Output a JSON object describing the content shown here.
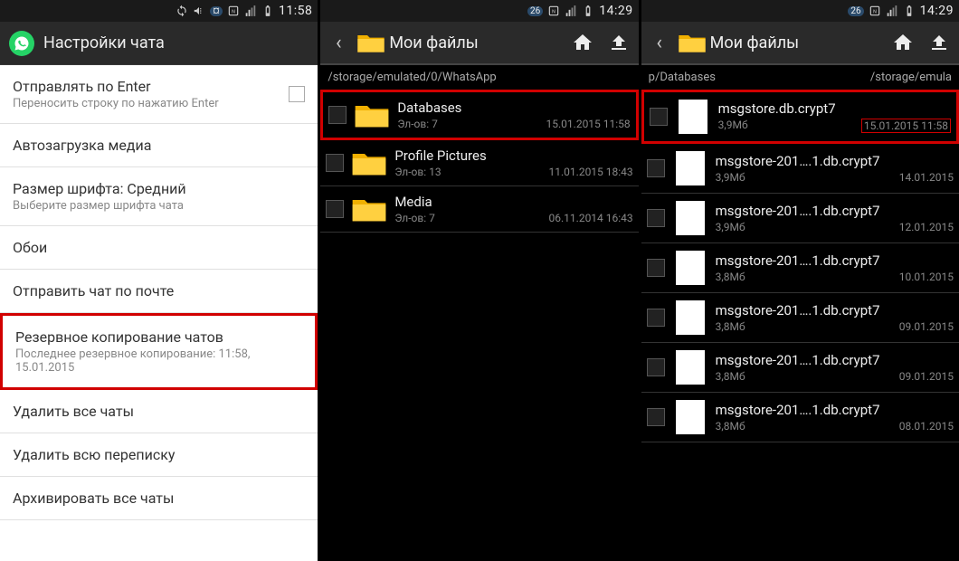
{
  "phone1": {
    "status": {
      "time": "11:58"
    },
    "header": {
      "title": "Настройки чата"
    },
    "settings": [
      {
        "title": "Отправлять по Enter",
        "sub": "Переносить строку по нажатию Enter",
        "checkbox": true
      },
      {
        "title": "Автозагрузка медиа"
      },
      {
        "title": "Размер шрифта: Средний",
        "sub": "Выберите размер шрифта чата"
      },
      {
        "title": "Обои"
      },
      {
        "title": "Отправить чат по почте"
      },
      {
        "title": "Резервное копирование чатов",
        "sub": "Последнее резервное копирование: 11:58, 15.01.2015",
        "highlight": true
      },
      {
        "title": "Удалить все чаты"
      },
      {
        "title": "Удалить всю переписку"
      },
      {
        "title": "Архивировать все чаты"
      }
    ]
  },
  "phone2": {
    "status": {
      "time": "14:29"
    },
    "header": {
      "title": "Мои файлы"
    },
    "path": "/storage/emulated/0/WhatsApp",
    "items": [
      {
        "name": "Databases",
        "meta": "Эл-ов: 7",
        "date": "15.01.2015 11:58",
        "highlight": true
      },
      {
        "name": "Profile Pictures",
        "meta": "Эл-ов: 13",
        "date": "11.01.2015 18:43"
      },
      {
        "name": "Media",
        "meta": "Эл-ов: 7",
        "date": "06.11.2014 16:43"
      }
    ]
  },
  "phone3": {
    "status": {
      "time": "14:29"
    },
    "header": {
      "title": "Мои файлы"
    },
    "path_left": "p/Databases",
    "path_right": "/storage/emula",
    "items": [
      {
        "name": "msgstore.db.crypt7",
        "meta": "3,9Мб",
        "date": "15.01.2015 11:58",
        "highlight": true,
        "date_highlight": true
      },
      {
        "name": "msgstore-201….1.db.crypt7",
        "meta": "3,9Мб",
        "date": "14.01.2015"
      },
      {
        "name": "msgstore-201….1.db.crypt7",
        "meta": "3,9Мб",
        "date": "12.01.2015"
      },
      {
        "name": "msgstore-201….1.db.crypt7",
        "meta": "3,8Мб",
        "date": "10.01.2015"
      },
      {
        "name": "msgstore-201….1.db.crypt7",
        "meta": "3,8Мб",
        "date": "09.01.2015"
      },
      {
        "name": "msgstore-201….1.db.crypt7",
        "meta": "3,8Мб",
        "date": "09.01.2015"
      },
      {
        "name": "msgstore-201….1.db.crypt7",
        "meta": "3,8Мб",
        "date": "08.01.2015"
      }
    ]
  }
}
